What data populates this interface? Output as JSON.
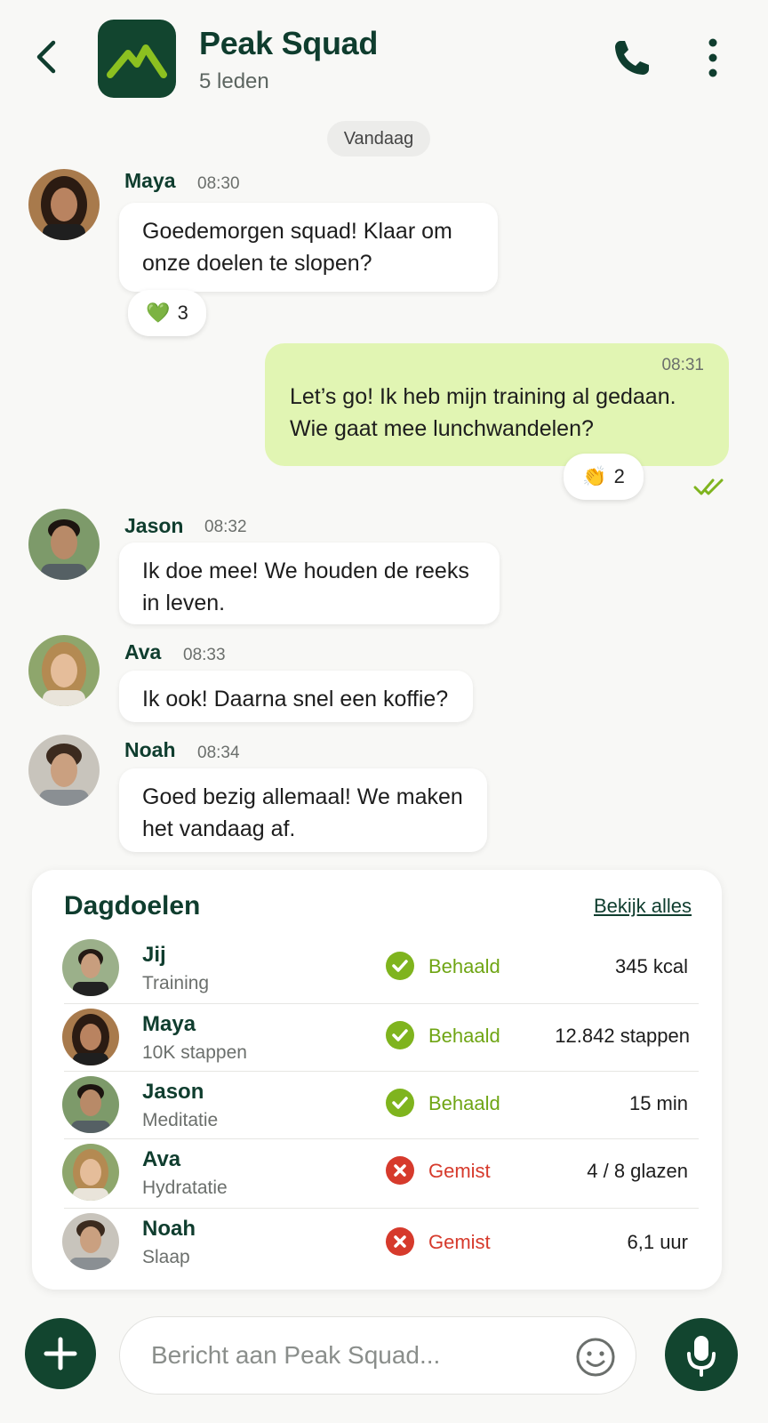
{
  "header": {
    "title": "Peak Squad",
    "subtitle": "5 leden",
    "logo_icon": "mountain-icon",
    "call_icon": "phone-icon",
    "more_icon": "more-vertical-icon",
    "back_icon": "chevron-left-icon"
  },
  "date_chip": "Vandaag",
  "messages": [
    {
      "name": "Maya",
      "time": "08:30",
      "text": "Goedemorgen squad! Klaar om onze doelen te slopen?",
      "reaction": {
        "emoji": "💚",
        "count": "3"
      }
    },
    {
      "outgoing": true,
      "time": "08:31",
      "text": "Let’s go!  Ik heb mijn training al gedaan. Wie gaat mee lunchwandelen?",
      "reaction": {
        "emoji": "👏",
        "count": "2"
      },
      "read_icon": "double-check-icon"
    },
    {
      "name": "Jason",
      "time": "08:32",
      "text": "Ik doe mee! We houden de reeks in leven."
    },
    {
      "name": "Ava",
      "time": "08:33",
      "text": "Ik ook! Daarna snel een koffie?"
    },
    {
      "name": "Noah",
      "time": "08:34",
      "text": "Goed bezig allemaal! We maken het vandaag af."
    }
  ],
  "goals": {
    "title": "Dagdoelen",
    "link": "Bekijk alles",
    "rows": [
      {
        "name": "Jij",
        "goal": "Training",
        "status": "Behaald",
        "metric": "345 kcal",
        "achieved": true
      },
      {
        "name": "Maya",
        "goal": "10K stappen",
        "status": "Behaald",
        "metric": "12.842 stappen",
        "achieved": true
      },
      {
        "name": "Jason",
        "goal": "Meditatie",
        "status": "Behaald",
        "metric": "15 min",
        "achieved": true
      },
      {
        "name": "Ava",
        "goal": "Hydratatie",
        "status": "Gemist",
        "metric": "4 / 8 glazen",
        "achieved": false
      },
      {
        "name": "Noah",
        "goal": "Slaap",
        "status": "Gemist",
        "metric": "6,1 uur",
        "achieved": false
      }
    ]
  },
  "composer": {
    "placeholder": "Bericht aan Peak Squad...",
    "plus_icon": "plus-icon",
    "emoji_icon": "smiley-icon",
    "mic_icon": "microphone-icon"
  },
  "colors": {
    "brand": "#12452f",
    "accent": "#8cc020",
    "outgoing_bubble": "#e1f5b3",
    "success": "#6fa514",
    "danger": "#d63a2c"
  }
}
